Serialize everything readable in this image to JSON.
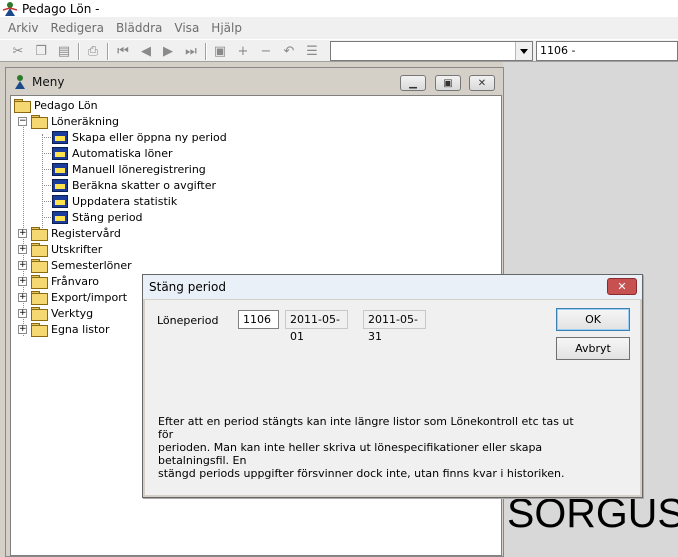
{
  "app": {
    "title": "Pedago Lön -",
    "icon": "app-icon"
  },
  "menubar": [
    "Arkiv",
    "Redigera",
    "Bläddra",
    "Visa",
    "Hjälp"
  ],
  "toolbar": {
    "buttons": [
      "cut-icon",
      "copy-icon",
      "paste-icon",
      "print-icon",
      "first-record-icon",
      "prev-record-icon",
      "next-record-icon",
      "last-record-icon",
      "save-icon",
      "add-icon",
      "remove-icon",
      "undo-icon",
      "list-icon"
    ],
    "combo_value": "",
    "period_value": "1106 -"
  },
  "meny": {
    "title": "Meny",
    "root": "Pedago Lön",
    "loneräkning": {
      "label": "Löneräkning",
      "items": [
        "Skapa eller öppna ny period",
        "Automatiska löner",
        "Manuell löneregistrering",
        "Beräkna skatter o avgifter",
        "Uppdatera statistik",
        "Stäng period"
      ]
    },
    "folders": [
      "Registervård",
      "Utskrifter",
      "Semesterlöner",
      "Frånvaro",
      "Export/import",
      "Verktyg",
      "Egna listor"
    ]
  },
  "background_text": "SORGUS",
  "dialog": {
    "title": "Stäng period",
    "period_label": "Löneperiod",
    "period": "1106",
    "start_date": "2011-05-01",
    "end_date": "2011-05-31",
    "ok_label": "OK",
    "cancel_label": "Avbryt",
    "info_line1": "Efter att en period stängts kan inte längre listor som Lönekontroll etc tas ut för",
    "info_line2": "perioden. Man kan inte heller skriva ut lönespecifikationer eller skapa betalningsfil. En",
    "info_line3": "stängd periods uppgifter försvinner dock inte, utan finns kvar i historiken."
  }
}
